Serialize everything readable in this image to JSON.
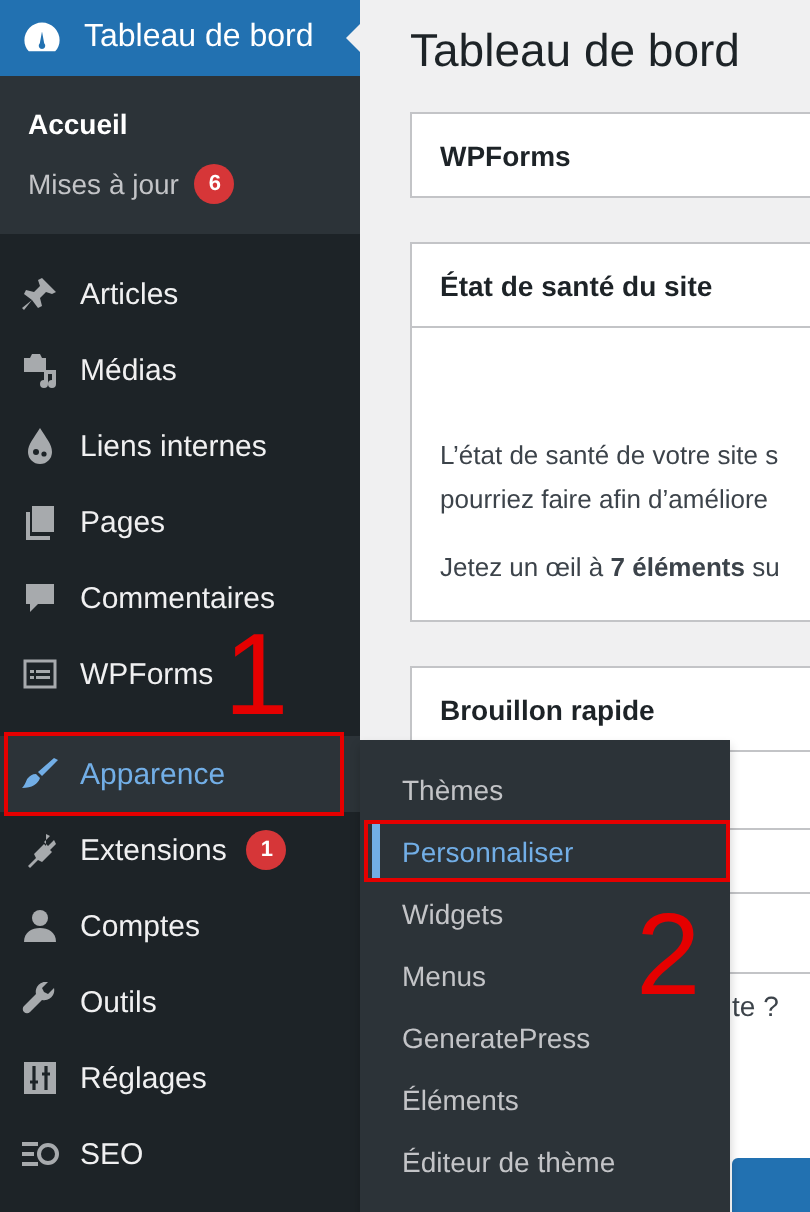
{
  "sidebar": {
    "current_item": {
      "label": "Tableau de bord"
    },
    "submenu": [
      {
        "label": "Accueil",
        "selected": true
      },
      {
        "label": "Mises à jour",
        "selected": false,
        "badge": "6"
      }
    ],
    "groups": [
      {
        "items": [
          {
            "label": "Articles",
            "highlighted": false,
            "boxed": false
          },
          {
            "label": "Médias",
            "highlighted": false,
            "boxed": false
          },
          {
            "label": "Liens internes",
            "highlighted": false,
            "boxed": false
          },
          {
            "label": "Pages",
            "highlighted": false,
            "boxed": false
          },
          {
            "label": "Commentaires",
            "highlighted": false,
            "boxed": false
          },
          {
            "label": "WPForms",
            "highlighted": false,
            "boxed": false
          }
        ]
      },
      {
        "items": [
          {
            "label": "Apparence",
            "highlighted": true,
            "boxed": true
          },
          {
            "label": "Extensions",
            "highlighted": false,
            "boxed": false,
            "badge": "1"
          },
          {
            "label": "Comptes",
            "highlighted": false,
            "boxed": false
          },
          {
            "label": "Outils",
            "highlighted": false,
            "boxed": false
          },
          {
            "label": "Réglages",
            "highlighted": false,
            "boxed": false
          },
          {
            "label": "SEO",
            "highlighted": false,
            "boxed": false
          }
        ]
      }
    ]
  },
  "flyout": [
    {
      "label": "Thèmes",
      "selected": false,
      "boxed": false
    },
    {
      "label": "Personnaliser",
      "selected": true,
      "boxed": true
    },
    {
      "label": "Widgets",
      "selected": false,
      "boxed": false
    },
    {
      "label": "Menus",
      "selected": false,
      "boxed": false
    },
    {
      "label": "GeneratePress",
      "selected": false,
      "boxed": false
    },
    {
      "label": "Éléments",
      "selected": false,
      "boxed": false
    },
    {
      "label": "Éditeur de thème",
      "selected": false,
      "boxed": false
    }
  ],
  "annotations": [
    {
      "label": "1"
    },
    {
      "label": "2"
    }
  ],
  "main": {
    "title": "Tableau de bord",
    "wpforms_card": {
      "title": "WPForms"
    },
    "health_card": {
      "title": "État de santé du site",
      "lines": [
        "L’état de santé de votre site s",
        "pourriez faire afin d’améliore"
      ],
      "summary": "Jetez un œil à **7 éléments** su"
    },
    "draft_card": {
      "title": "Brouillon rapide",
      "fragment": "te ?"
    }
  }
}
